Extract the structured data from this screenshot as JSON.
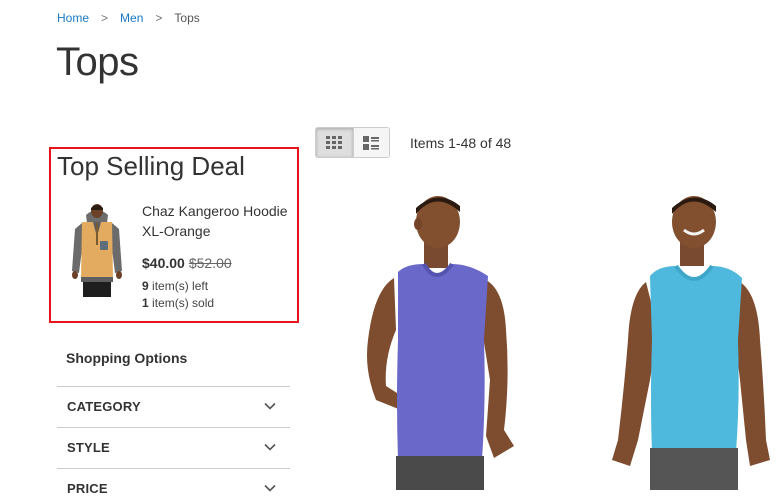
{
  "breadcrumb": {
    "items": [
      {
        "label": "Home"
      },
      {
        "label": "Men"
      },
      {
        "label": "Tops"
      }
    ],
    "separator": ">"
  },
  "page_title": "Tops",
  "deal": {
    "title": "Top Selling Deal",
    "product_name": "Chaz Kangeroo Hoodie XL-Orange",
    "price": "$40.00",
    "old_price": "$52.00",
    "left_count": "9",
    "left_text": "item(s) left",
    "sold_count": "1",
    "sold_text": "item(s) sold",
    "border_color": "#e8141b"
  },
  "sidebar": {
    "title": "Shopping Options",
    "filters": [
      {
        "label": "CATEGORY"
      },
      {
        "label": "STYLE"
      },
      {
        "label": "PRICE"
      }
    ]
  },
  "toolbar": {
    "modes": [
      {
        "name": "grid",
        "icon": "grid-icon",
        "active": true
      },
      {
        "name": "list",
        "icon": "list-icon",
        "active": false
      }
    ],
    "items_text": "Items 1-48 of 48"
  },
  "products": [
    {
      "icon": "purple-tank-top-photo",
      "shirt_color": "#6a68c8"
    },
    {
      "icon": "blue-tank-top-photo",
      "shirt_color": "#4fb9dd"
    }
  ],
  "colors": {
    "link": "#1979c3",
    "text": "#333333"
  }
}
